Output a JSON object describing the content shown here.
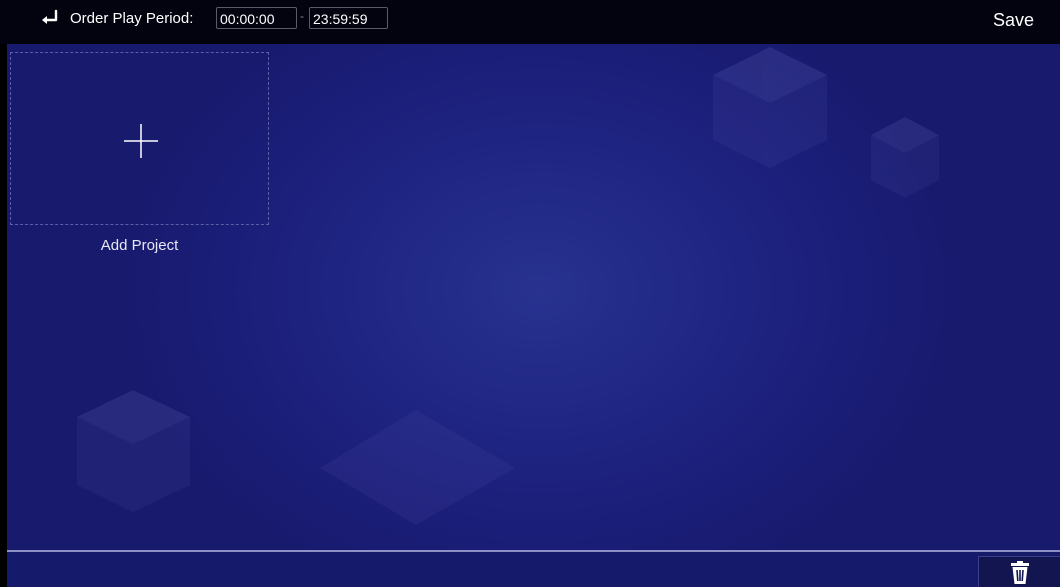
{
  "header": {
    "back_icon": "return-arrow-icon",
    "period_label": "Order Play Period:",
    "start_time": "00:00:00",
    "separator": "-",
    "end_time": "23:59:59",
    "save_label": "Save"
  },
  "main": {
    "add_project": {
      "icon": "plus-icon",
      "label": "Add Project"
    }
  },
  "footer": {
    "delete_icon": "trash-icon"
  },
  "colors": {
    "background": "#1f2583",
    "topbar": "#03030f",
    "text": "#ffffff"
  }
}
